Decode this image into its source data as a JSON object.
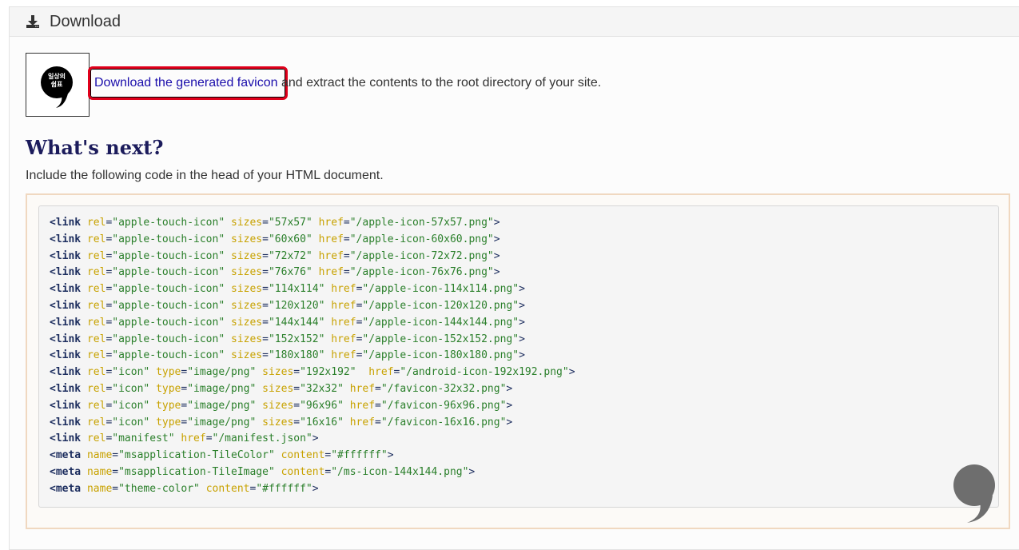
{
  "panel": {
    "title": "Download"
  },
  "favicon": {
    "line1": "일상의",
    "line2": "쉼표"
  },
  "download": {
    "link_text": "Download the generated favicon",
    "rest_text": " and extract the contents to the root directory of your site."
  },
  "whats_next": {
    "heading": "What's next?",
    "intro": "Include the following code in the head of your HTML document."
  },
  "code_lines": [
    "<link rel=\"apple-touch-icon\" sizes=\"57x57\" href=\"/apple-icon-57x57.png\">",
    "<link rel=\"apple-touch-icon\" sizes=\"60x60\" href=\"/apple-icon-60x60.png\">",
    "<link rel=\"apple-touch-icon\" sizes=\"72x72\" href=\"/apple-icon-72x72.png\">",
    "<link rel=\"apple-touch-icon\" sizes=\"76x76\" href=\"/apple-icon-76x76.png\">",
    "<link rel=\"apple-touch-icon\" sizes=\"114x114\" href=\"/apple-icon-114x114.png\">",
    "<link rel=\"apple-touch-icon\" sizes=\"120x120\" href=\"/apple-icon-120x120.png\">",
    "<link rel=\"apple-touch-icon\" sizes=\"144x144\" href=\"/apple-icon-144x144.png\">",
    "<link rel=\"apple-touch-icon\" sizes=\"152x152\" href=\"/apple-icon-152x152.png\">",
    "<link rel=\"apple-touch-icon\" sizes=\"180x180\" href=\"/apple-icon-180x180.png\">",
    "<link rel=\"icon\" type=\"image/png\" sizes=\"192x192\"  href=\"/android-icon-192x192.png\">",
    "<link rel=\"icon\" type=\"image/png\" sizes=\"32x32\" href=\"/favicon-32x32.png\">",
    "<link rel=\"icon\" type=\"image/png\" sizes=\"96x96\" href=\"/favicon-96x96.png\">",
    "<link rel=\"icon\" type=\"image/png\" sizes=\"16x16\" href=\"/favicon-16x16.png\">",
    "<link rel=\"manifest\" href=\"/manifest.json\">",
    "<meta name=\"msapplication-TileColor\" content=\"#ffffff\">",
    "<meta name=\"msapplication-TileImage\" content=\"/ms-icon-144x144.png\">",
    "<meta name=\"theme-color\" content=\"#ffffff\">"
  ],
  "icons": {
    "download": "download-icon",
    "floating": "comma-icon"
  },
  "colors": {
    "highlight": "#e0001b",
    "link": "#1a0dab",
    "heading": "#1c1c5c",
    "code_tag": "#1c2d5e",
    "code_attr": "#c8a200",
    "code_value": "#2a7f2a"
  }
}
